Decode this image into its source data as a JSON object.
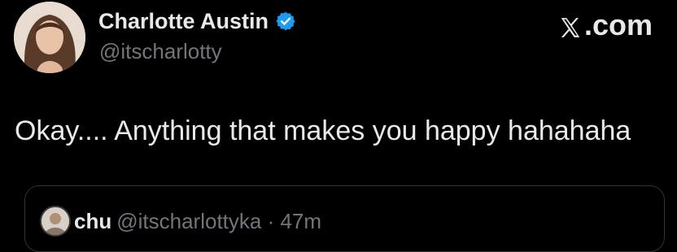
{
  "author": {
    "display_name": "Charlotte Austin",
    "handle": "@itscharlotty",
    "verified": true,
    "avatar_icon": "profile-photo"
  },
  "brand": {
    "label": ".com",
    "icon": "x-logo-icon"
  },
  "tweet": {
    "text": "Okay.... Anything that makes you happy hahahaha"
  },
  "quoted": {
    "name": "chu",
    "handle_time": "@itscharlottyka · 47m",
    "avatar_icon": "profile-photo"
  },
  "colors": {
    "background": "#000000",
    "text": "#e7e9ea",
    "secondary_text": "#71767b",
    "verified_blue": "#1d9bf0",
    "border": "#2f3336"
  }
}
